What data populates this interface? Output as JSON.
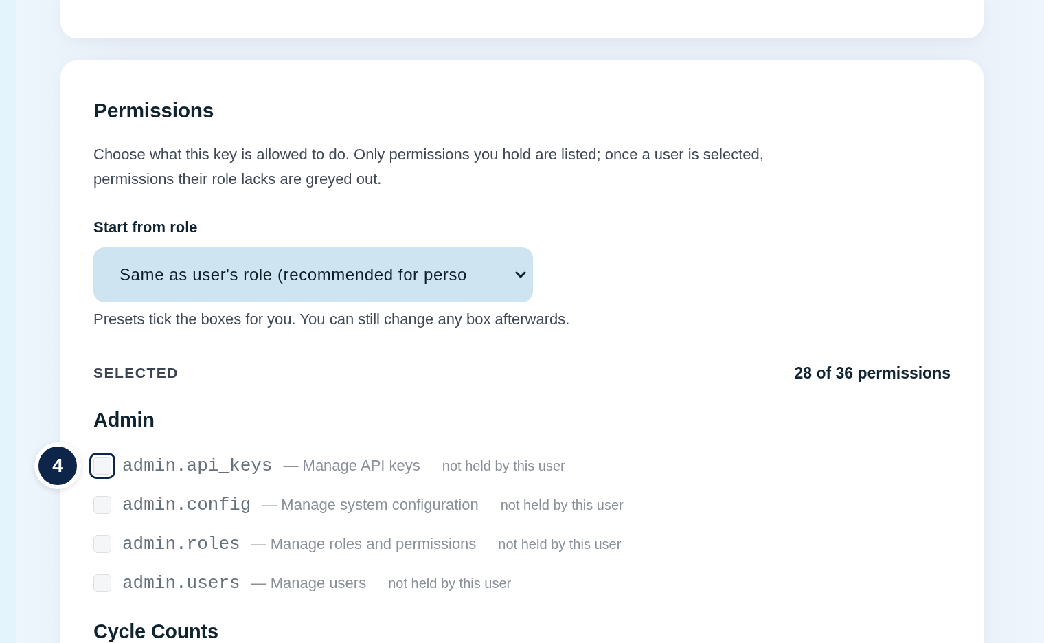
{
  "permissions_card": {
    "title": "Permissions",
    "description": "Choose what this key is allowed to do. Only permissions you hold are listed; once a user is selected, permissions their role lacks are greyed out.",
    "role_select": {
      "label": "Start from role",
      "value": "Same as user's role (recommended for perso",
      "hint": "Presets tick the boxes for you. You can still change any box afterwards."
    },
    "selected_label": "SELECTED",
    "selected_count": "28 of 36 permissions",
    "groups": [
      {
        "title": "Admin",
        "permissions": [
          {
            "code": "admin.api_keys",
            "description": "— Manage API keys",
            "note": "not held by this user",
            "checked": false,
            "disabled": true,
            "focused": true,
            "marker": "4"
          },
          {
            "code": "admin.config",
            "description": "— Manage system configuration",
            "note": "not held by this user",
            "checked": false,
            "disabled": true,
            "focused": false
          },
          {
            "code": "admin.roles",
            "description": "— Manage roles and permissions",
            "note": "not held by this user",
            "checked": false,
            "disabled": true,
            "focused": false
          },
          {
            "code": "admin.users",
            "description": "— Manage users",
            "note": "not held by this user",
            "checked": false,
            "disabled": true,
            "focused": false
          }
        ]
      },
      {
        "title": "Cycle Counts"
      }
    ]
  }
}
